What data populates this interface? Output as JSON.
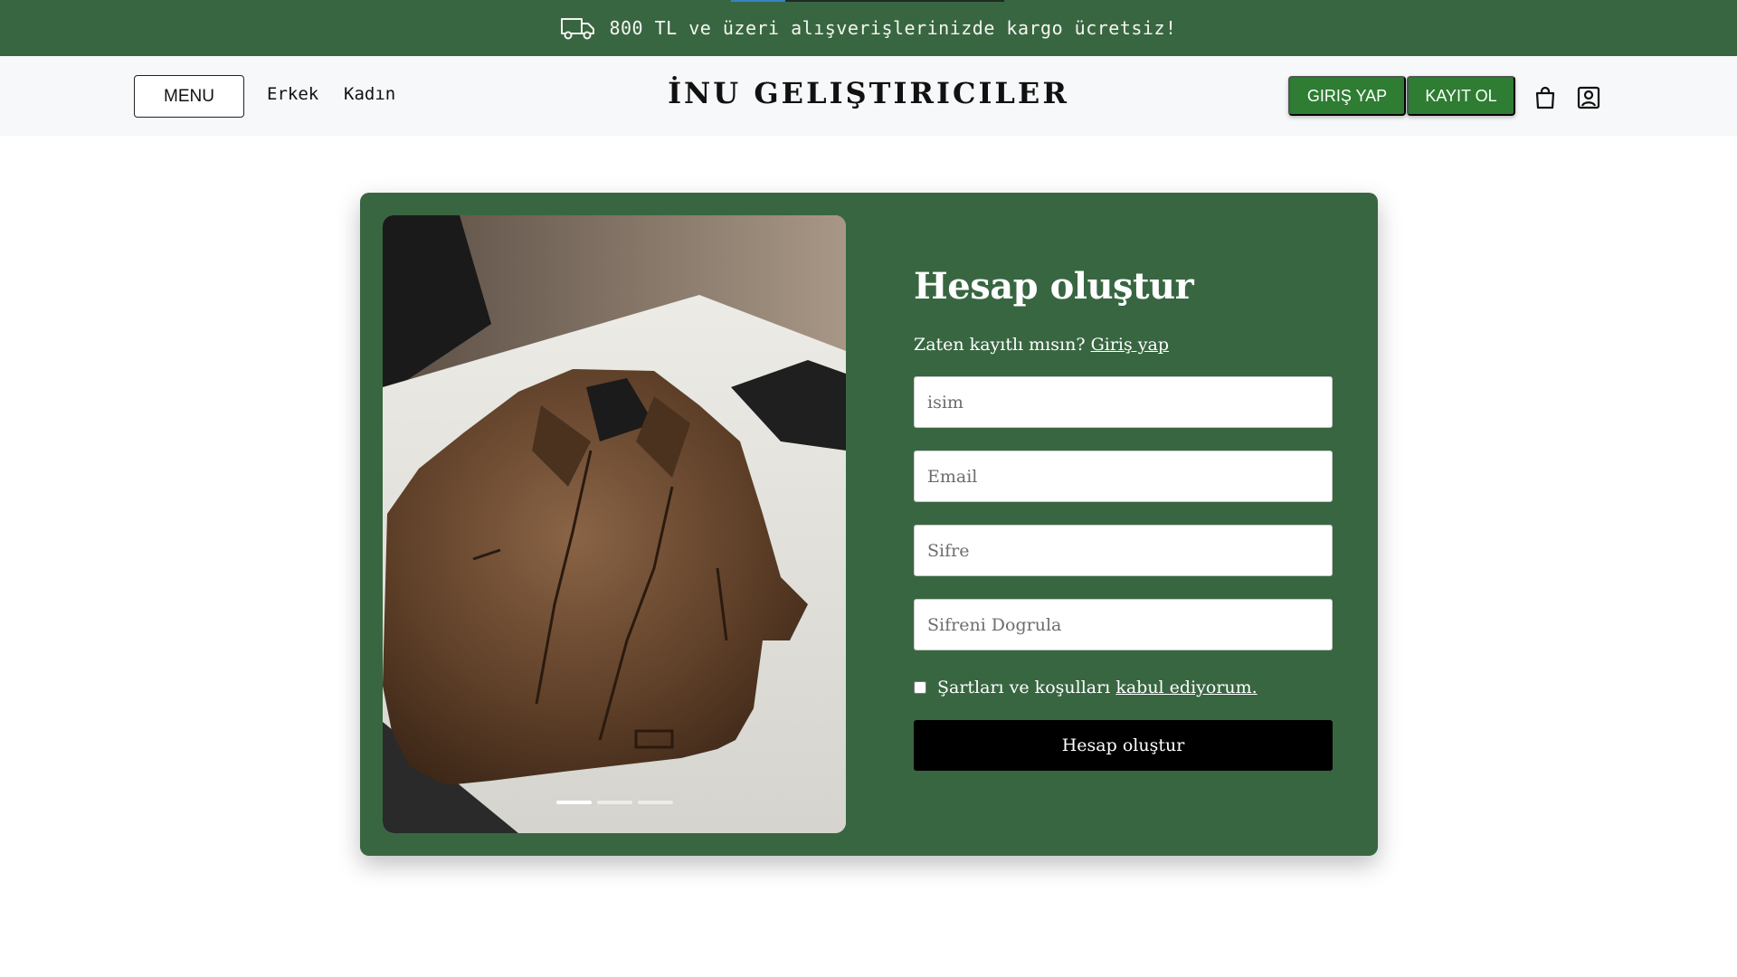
{
  "promo": {
    "icon": "truck-icon",
    "text": "800 TL ve üzeri alışverişlerinizde kargo ücretsiz!"
  },
  "header": {
    "menu_label": "MENU",
    "nav": [
      "Erkek",
      "Kadın"
    ],
    "brand": "İNU GELIŞTIRICILER",
    "login_label": "GIRIŞ YAP",
    "register_label": "KAYIT OL",
    "icons": [
      "shopping-bag-icon",
      "user-profile-icon"
    ]
  },
  "signup": {
    "title": "Hesap oluştur",
    "already_text": "Zaten kayıtlı mısın?",
    "login_link": "Giriş yap",
    "fields": [
      {
        "placeholder": "isim",
        "value": ""
      },
      {
        "placeholder": "Email",
        "value": ""
      },
      {
        "placeholder": "Sifre",
        "value": ""
      },
      {
        "placeholder": "Sifreni Dogrula",
        "value": ""
      }
    ],
    "terms_text": "Şartları ve koşulları",
    "terms_link": "kabul ediyorum.",
    "terms_checked": false,
    "submit_label": "Hesap oluştur"
  },
  "carousel": {
    "image": "brown-leather-jacket-photo",
    "slide_count": 3,
    "active_slide": 1
  },
  "colors": {
    "brand_green": "#386641",
    "button_green": "#2e7d32",
    "submit_black": "#000000"
  }
}
